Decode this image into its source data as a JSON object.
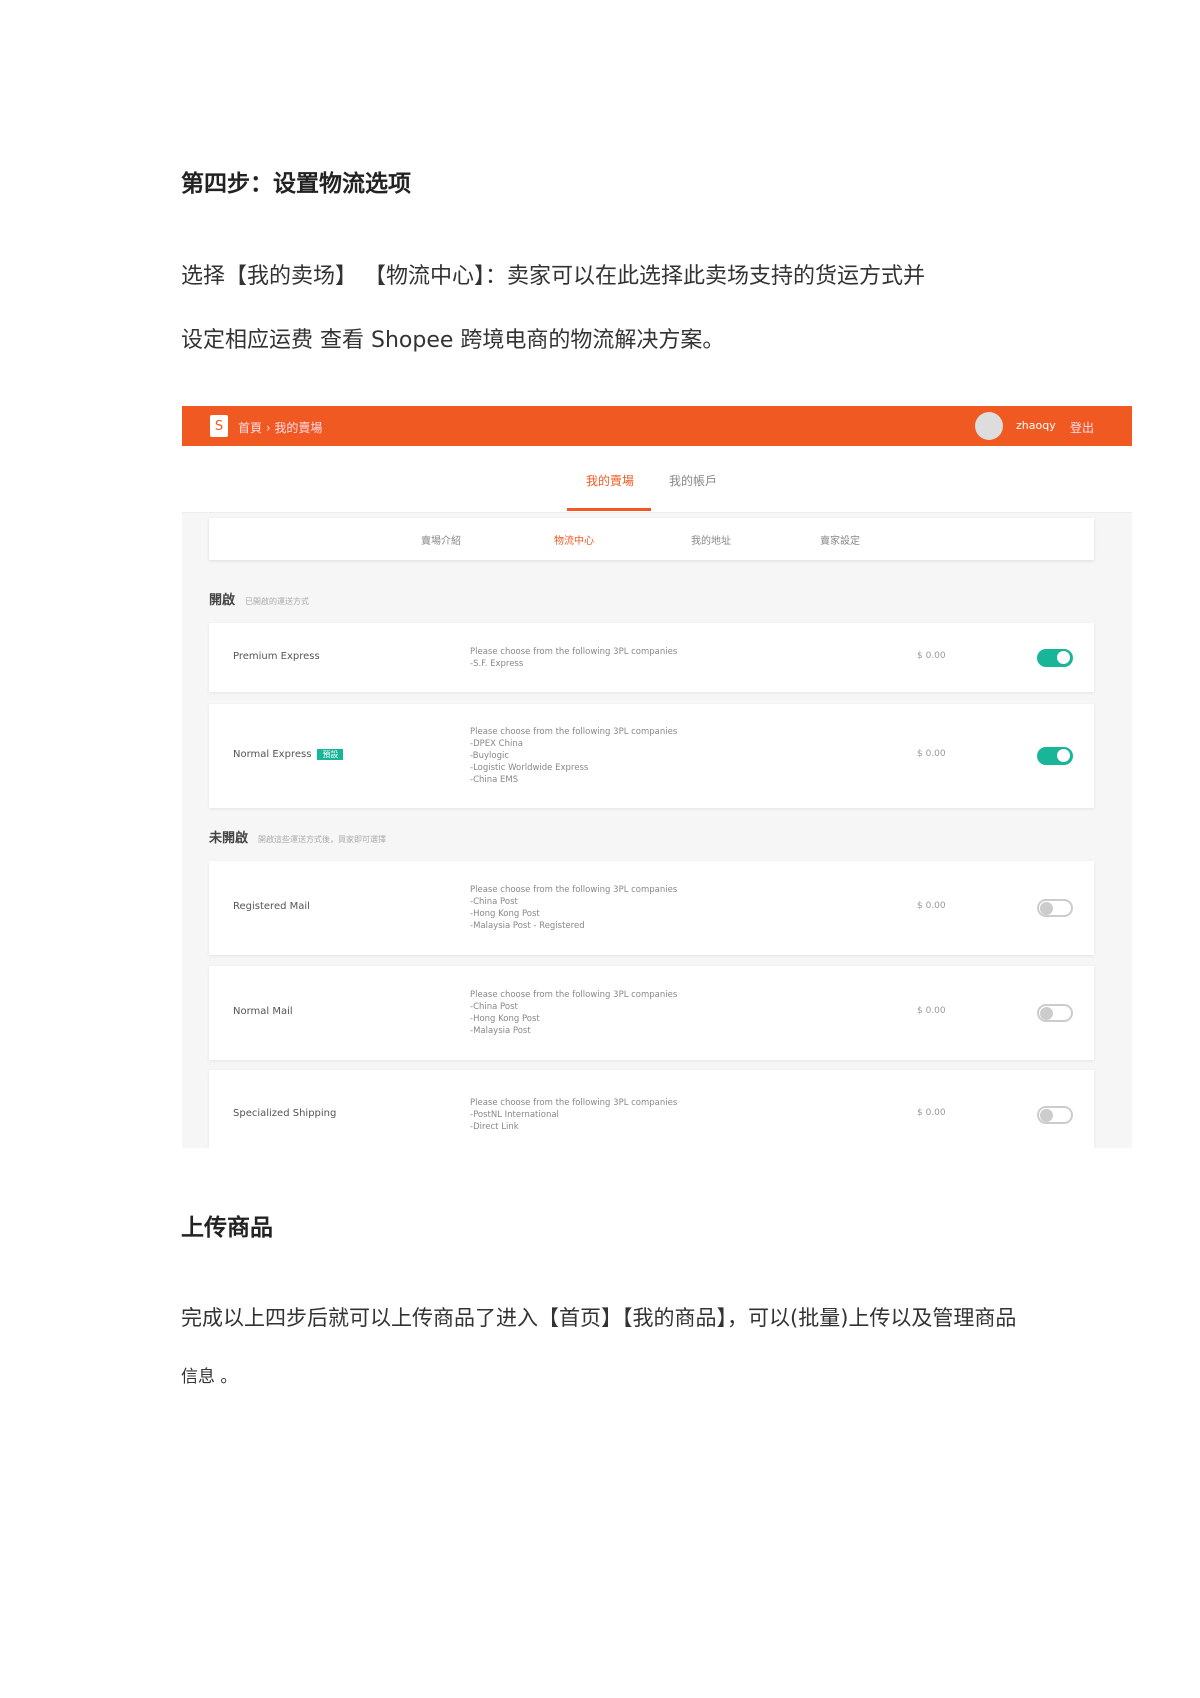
{
  "step_heading": "第四步：设置物流选项",
  "intro_lines": [
    "选择【我的卖场】 【物流中心】：卖家可以在此选择此卖场支持的货运方式并",
    "设定相应运费   查看 Shopee 跨境电商的物流解决方案。"
  ],
  "screenshot": {
    "breadcrumb": "首頁 › 我的賣場",
    "username": "zhaoqy",
    "logout": "登出",
    "tabs": [
      "我的賣場",
      "我的帳戶"
    ],
    "subnav": [
      "賣場介紹",
      "物流中心",
      "我的地址",
      "賣家設定"
    ],
    "enabled_section": {
      "title": "開啟",
      "hint": "已開啟的運送方式"
    },
    "disabled_section": {
      "title": "未開啟",
      "hint": "開啟這些運送方式後，買家即可選擇"
    },
    "channels": [
      {
        "name": "Premium Express",
        "badge": null,
        "desc": [
          "Please choose from the following 3PL companies",
          "-S.F. Express"
        ],
        "price": "$ 0.00",
        "enabled": true
      },
      {
        "name": "Normal Express",
        "badge": "預設",
        "desc": [
          "Please choose from the following 3PL companies",
          "-DPEX China",
          "-Buylogic",
          "-Logistic Worldwide Express",
          "-China EMS"
        ],
        "price": "$ 0.00",
        "enabled": true
      },
      {
        "name": "Registered Mail",
        "badge": null,
        "desc": [
          "Please choose from the following 3PL companies",
          "-China Post",
          "-Hong Kong Post",
          "-Malaysia Post - Registered"
        ],
        "price": "$ 0.00",
        "enabled": false
      },
      {
        "name": "Normal Mail",
        "badge": null,
        "desc": [
          "Please choose from the following 3PL companies",
          "-China Post",
          "-Hong Kong Post",
          "-Malaysia Post"
        ],
        "price": "$ 0.00",
        "enabled": false
      },
      {
        "name": "Specialized Shipping",
        "badge": null,
        "desc": [
          "Please choose from the following 3PL companies",
          "-PostNL International",
          "-Direct Link"
        ],
        "price": "$ 0.00",
        "enabled": false
      }
    ],
    "colors": {
      "brand": "#f05a22",
      "toggle_on": "#19b598"
    }
  },
  "upload_heading": "上传商品",
  "upload_lines": [
    "完成以上四步后就可以上传商品了进入【首页】【我的商品】，可以(批量)上传以及管理商品",
    "信息 。"
  ]
}
